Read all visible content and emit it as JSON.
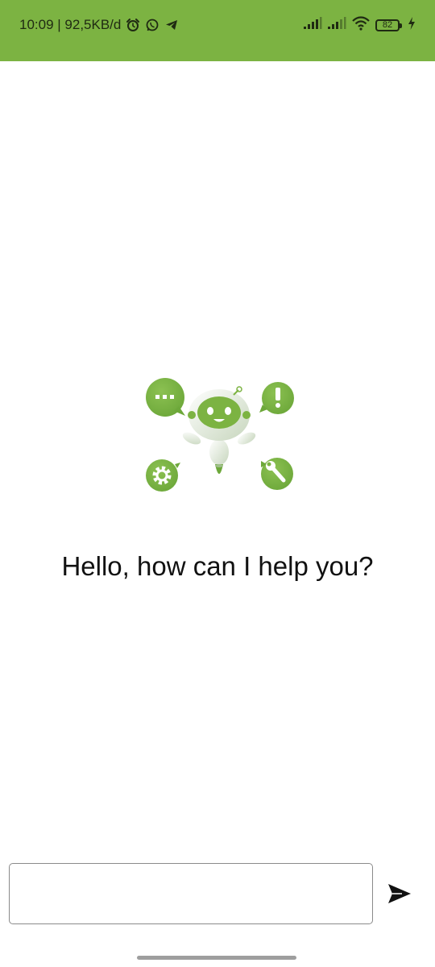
{
  "status_bar": {
    "time_network": "10:09 | 92,5KB/d",
    "battery_level": "82",
    "icons": [
      "alarm-icon",
      "whatsapp-icon",
      "telegram-icon",
      "signal-icon",
      "signal-icon",
      "wifi-icon",
      "battery-icon",
      "charging-icon"
    ]
  },
  "chat": {
    "greeting": "Hello, how can I help you?",
    "illustration": "chatbot-robot-illustration"
  },
  "composer": {
    "input_value": "",
    "input_placeholder": "",
    "send_icon": "send-icon"
  },
  "colors": {
    "accent": "#7cb342",
    "background": "#ffffff",
    "text": "#111111"
  }
}
